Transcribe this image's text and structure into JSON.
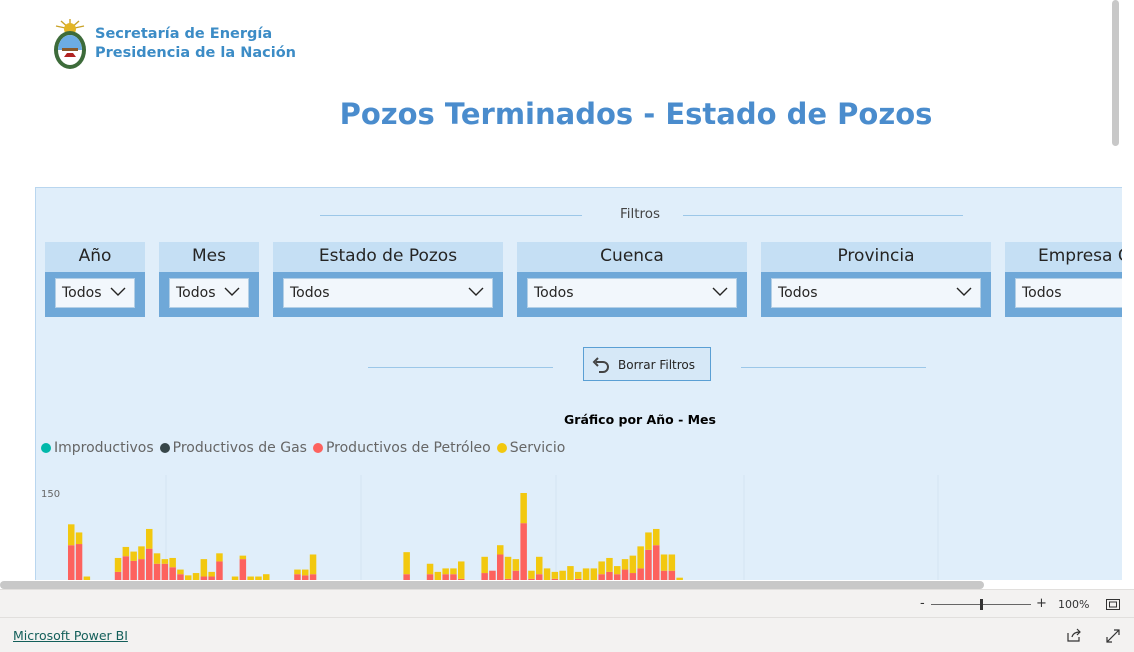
{
  "header": {
    "logo_line1": "Secretaría de Energía",
    "logo_line2": "Presidencia de la Nación",
    "title": "Pozos Terminados - Estado de Pozos"
  },
  "filters": {
    "section_label": "Filtros",
    "slicers": [
      {
        "label": "Año",
        "value": "Todos"
      },
      {
        "label": "Mes",
        "value": "Todos"
      },
      {
        "label": "Estado de Pozos",
        "value": "Todos"
      },
      {
        "label": "Cuenca",
        "value": "Todos"
      },
      {
        "label": "Provincia",
        "value": "Todos"
      },
      {
        "label": "Empresa Operadora",
        "value": "Todos"
      }
    ],
    "clear_button": "Borrar Filtros"
  },
  "chart_data": {
    "type": "bar",
    "stacked": true,
    "title": "Gráfico  por Año - Mes",
    "y_tick_label": "150",
    "ylim": [
      0,
      150
    ],
    "series": [
      {
        "name": "Improductivos",
        "color": "#01b8aa",
        "values": []
      },
      {
        "name": "Productivos de Gas",
        "color": "#374649",
        "values": []
      },
      {
        "name": "Productivos de Petróleo",
        "color": "#fd625e",
        "values": [
          60,
          62,
          0,
          0,
          0,
          0,
          14,
          41,
          33,
          36,
          54,
          28,
          28,
          22,
          10,
          0,
          0,
          6,
          6,
          32,
          0,
          0,
          36,
          0,
          0,
          0,
          0,
          0,
          0,
          10,
          8,
          10,
          0,
          0,
          0,
          0,
          0,
          0,
          0,
          0,
          0,
          0,
          0,
          10,
          0,
          0,
          10,
          0,
          10,
          10,
          2,
          0,
          0,
          12,
          16,
          44,
          2,
          16,
          98,
          2,
          10,
          0,
          2,
          0,
          0,
          2,
          0,
          0,
          10,
          14,
          10,
          18,
          12,
          20,
          52,
          60,
          16,
          16,
          0
        ]
      },
      {
        "name": "Servicio",
        "color": "#f2c80f",
        "values": [
          36,
          20,
          6,
          0,
          0,
          0,
          24,
          16,
          16,
          22,
          34,
          18,
          8,
          16,
          8,
          8,
          12,
          30,
          8,
          14,
          0,
          6,
          6,
          6,
          6,
          10,
          0,
          0,
          0,
          8,
          10,
          34,
          0,
          0,
          0,
          0,
          0,
          0,
          0,
          0,
          0,
          0,
          0,
          38,
          0,
          0,
          18,
          14,
          10,
          10,
          30,
          0,
          0,
          28,
          0,
          16,
          38,
          20,
          52,
          14,
          30,
          20,
          12,
          16,
          24,
          12,
          20,
          20,
          22,
          24,
          14,
          18,
          30,
          38,
          30,
          28,
          28,
          28,
          4
        ]
      }
    ]
  },
  "zoom": {
    "minus": "-",
    "plus": "+",
    "level": "100%"
  },
  "footer": {
    "link": "Microsoft Power BI"
  }
}
